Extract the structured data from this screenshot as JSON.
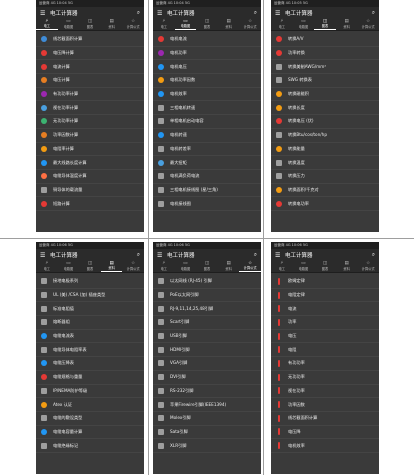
{
  "panels": [
    {
      "status": "运营商 4G 10:04 5G",
      "title": "电工计算器",
      "tabs": [
        "电工",
        "电路图",
        "图表",
        "资料",
        "计算公式"
      ],
      "active_tab": 0,
      "items": [
        {
          "icon": "#3f8cd8",
          "label": "线芯截面积计算"
        },
        {
          "icon": "#e53935",
          "label": "电压降计算"
        },
        {
          "icon": "#e53935",
          "label": "电流计算"
        },
        {
          "icon": "#e67e22",
          "label": "电压计算"
        },
        {
          "icon": "#9c27b0",
          "label": "有功功率计算"
        },
        {
          "icon": "#4aa0e0",
          "label": "视在功率计算"
        },
        {
          "icon": "#3cb371",
          "label": "无功功率计算"
        },
        {
          "icon": "#e67e22",
          "label": "功率因数计算"
        },
        {
          "icon": "#f39c12",
          "label": "电阻率计算"
        },
        {
          "icon": "#2196f3",
          "label": "最大线路长度计算"
        },
        {
          "icon": "#ff7043",
          "label": "电缆导体温度计算"
        },
        {
          "icon": "#9e9e9e",
          "label": "铜导体的载流量"
        },
        {
          "icon": "#e53935",
          "label": "短路计算"
        }
      ]
    },
    {
      "status": "运营商 4G 10:04 5G",
      "title": "电工计算器",
      "tabs": [
        "电工",
        "电路图",
        "图表",
        "资料",
        "计算公式"
      ],
      "active_tab": 1,
      "items": [
        {
          "icon": "#e53935",
          "label": "电机电流"
        },
        {
          "icon": "#9c27b0",
          "label": "电机功率"
        },
        {
          "icon": "#2196f3",
          "label": "电机电压"
        },
        {
          "icon": "#f39c12",
          "label": "电机功率因数"
        },
        {
          "icon": "#2196f3",
          "label": "电机效率"
        },
        {
          "icon": "#9e9e9e",
          "label": "三相电机转速"
        },
        {
          "icon": "#9e9e9e",
          "label": "单相电机启动电容"
        },
        {
          "icon": "#2196f3",
          "label": "电机转速"
        },
        {
          "icon": "#9e9e9e",
          "label": "电机转差率"
        },
        {
          "icon": "#4aa0e0",
          "label": "最大扭矩"
        },
        {
          "icon": "#9e9e9e",
          "label": "电机满负荷电流"
        },
        {
          "icon": "#9e9e9e",
          "label": "三相电机接线图 (星/三角)"
        },
        {
          "icon": "#9e9e9e",
          "label": "电机接线图"
        }
      ]
    },
    {
      "status": "运营商 4G 10:05 5G",
      "title": "电工计算器",
      "tabs": [
        "电工",
        "电路图",
        "图表",
        "资料",
        "计算公式"
      ],
      "active_tab": 2,
      "items": [
        {
          "icon": "#e53935",
          "label": "转换A/V"
        },
        {
          "icon": "#e53935",
          "label": "功率转换"
        },
        {
          "icon": "#9e9e9e",
          "label": "转换美制AWG/mm²"
        },
        {
          "icon": "#9e9e9e",
          "label": "SWG 转换表"
        },
        {
          "icon": "#f39c12",
          "label": "转换磁能积"
        },
        {
          "icon": "#f39c12",
          "label": "转换长度"
        },
        {
          "icon": "#e53935",
          "label": "转换电压 (伏)"
        },
        {
          "icon": "#9e9e9e",
          "label": "转换Btu/cos/ton/hp"
        },
        {
          "icon": "#f39c12",
          "label": "转换能量"
        },
        {
          "icon": "#9e9e9e",
          "label": "转换温度"
        },
        {
          "icon": "#9e9e9e",
          "label": "转换压力"
        },
        {
          "icon": "#f39c12",
          "label": "转换面积/千克对"
        },
        {
          "icon": "#e53935",
          "label": "转换电功率"
        }
      ]
    },
    {
      "status": "运营商 4G 10:06 5G",
      "title": "电工计算器",
      "tabs": [
        "电工",
        "电路图",
        "图表",
        "资料",
        "计算公式"
      ],
      "active_tab": 3,
      "items": [
        {
          "icon": "#9e9e9e",
          "label": "接地电极系列"
        },
        {
          "icon": "#9e9e9e",
          "label": "UL (美) /CSA (加) 插座类型"
        },
        {
          "icon": "#9e9e9e",
          "label": "标准电阻值"
        },
        {
          "icon": "#9e9e9e",
          "label": "熔断器组"
        },
        {
          "icon": "#2196f3",
          "label": "电缆电流表"
        },
        {
          "icon": "#9e9e9e",
          "label": "电缆导体电阻率表"
        },
        {
          "icon": "#2196f3",
          "label": "电缆压降表"
        },
        {
          "icon": "#e53935",
          "label": "电缆规格与重量"
        },
        {
          "icon": "#9e9e9e",
          "label": "IP/NEMA防护等级"
        },
        {
          "icon": "#f39c12",
          "label": "Atex 认证"
        },
        {
          "icon": "#9e9e9e",
          "label": "电缆的敷设类型"
        },
        {
          "icon": "#2196f3",
          "label": "电缆电容量计算"
        },
        {
          "icon": "#9e9e9e",
          "label": "电缆绝缘标记"
        }
      ]
    },
    {
      "status": "运营商 4G 10:06 5G",
      "title": "电工计算器",
      "tabs": [
        "电工",
        "电路图",
        "图表",
        "资料",
        "计算公式"
      ],
      "active_tab": 4,
      "items": [
        {
          "icon": "#9e9e9e",
          "label": "以太网线 (RJ-45) 引脚"
        },
        {
          "icon": "#9e9e9e",
          "label": "PoE以太网引脚"
        },
        {
          "icon": "#9e9e9e",
          "label": "RJ-9,11,14,25,48引脚"
        },
        {
          "icon": "#9e9e9e",
          "label": "Scart引脚"
        },
        {
          "icon": "#9e9e9e",
          "label": "USB引脚"
        },
        {
          "icon": "#9e9e9e",
          "label": "HDMI引脚"
        },
        {
          "icon": "#9e9e9e",
          "label": "VGA引脚"
        },
        {
          "icon": "#9e9e9e",
          "label": "DVI引脚"
        },
        {
          "icon": "#9e9e9e",
          "label": "RS-232引脚"
        },
        {
          "icon": "#9e9e9e",
          "label": "苹果Firewire引脚(IEEE1394)"
        },
        {
          "icon": "#9e9e9e",
          "label": "Molex引脚"
        },
        {
          "icon": "#9e9e9e",
          "label": "Sata引脚"
        },
        {
          "icon": "#9e9e9e",
          "label": "XLR引脚"
        }
      ]
    },
    {
      "status": "运营商 4G 10:06 5G",
      "title": "电工计算器",
      "tabs": [
        "电工",
        "电路图",
        "图表",
        "资料",
        "计算公式"
      ],
      "active_tab": 5,
      "items": [
        {
          "icon": "#e53935",
          "label": "欧姆定律"
        },
        {
          "icon": "#e53935",
          "label": "电阻定律"
        },
        {
          "icon": "#e53935",
          "label": "电流"
        },
        {
          "icon": "#e53935",
          "label": "功率"
        },
        {
          "icon": "#e53935",
          "label": "电压"
        },
        {
          "icon": "#e53935",
          "label": "电阻"
        },
        {
          "icon": "#e53935",
          "label": "有功功率"
        },
        {
          "icon": "#e53935",
          "label": "无功功率"
        },
        {
          "icon": "#e53935",
          "label": "视在功率"
        },
        {
          "icon": "#e53935",
          "label": "功率因数"
        },
        {
          "icon": "#e53935",
          "label": "线芯截面积计算"
        },
        {
          "icon": "#e53935",
          "label": "电压降"
        },
        {
          "icon": "#e53935",
          "label": "电机效率"
        }
      ]
    }
  ]
}
